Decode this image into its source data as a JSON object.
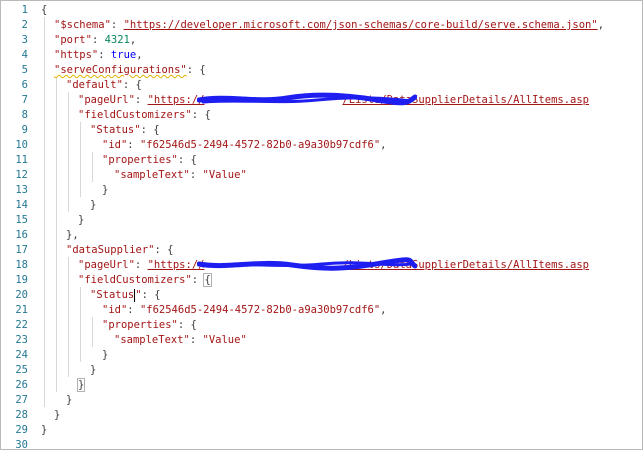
{
  "editor": {
    "line_numbers": [
      "1",
      "2",
      "3",
      "4",
      "5",
      "6",
      "7",
      "8",
      "9",
      "10",
      "11",
      "12",
      "13",
      "14",
      "15",
      "16",
      "17",
      "18",
      "19",
      "20",
      "21",
      "22",
      "23",
      "24",
      "25",
      "26",
      "27",
      "28",
      "29",
      "30"
    ],
    "colors": {
      "line_number": "#237893",
      "string": "#a31515",
      "number": "#098658",
      "keyword": "#0000ff",
      "punct": "#3b3b3b",
      "redaction": "#1e1ef0"
    }
  },
  "code": {
    "l1_brace": "{",
    "l2_key": "\"$schema\"",
    "l2_colon": ": ",
    "l2_value": "\"https://developer.microsoft.com/json-schemas/core-build/serve.schema.json\"",
    "l2_comma": ",",
    "l3_key": "\"port\"",
    "l3_colon": ": ",
    "l3_value": "4321",
    "l3_comma": ",",
    "l4_key": "\"https\"",
    "l4_colon": ": ",
    "l4_value": "true",
    "l4_comma": ",",
    "l5_key": "\"serveConfigurations\"",
    "l5_rest": ": {",
    "l6_key": "\"default\"",
    "l6_rest": ": {",
    "l7_key": "\"pageUrl\"",
    "l7_colon": ": ",
    "l7_value_start": "\"https://",
    "l7_value_end": "/Lists/DataSupplierDetails/AllItems.asp",
    "l8_key": "\"fieldCustomizers\"",
    "l8_rest": ": {",
    "l9_key": "\"Status\"",
    "l9_rest": ": {",
    "l10_key": "\"id\"",
    "l10_colon": ": ",
    "l10_value": "\"f62546d5-2494-4572-82b0-a9a30b97cdf6\"",
    "l10_comma": ",",
    "l11_key": "\"properties\"",
    "l11_rest": ": {",
    "l12_key": "\"sampleText\"",
    "l12_colon": ": ",
    "l12_value": "\"Value\"",
    "l13_text": "}",
    "l14_text": "}",
    "l15_text": "}",
    "l16_text": "},",
    "l17_key": "\"dataSupplier\"",
    "l17_rest": ": {",
    "l18_key": "\"pageUrl\"",
    "l18_colon": ": ",
    "l18_value_start": "\"https://",
    "l18_value_end": "/Lists/DataSupplierDetails/AllItems.asp",
    "l19_key": "\"fieldCustomizers\"",
    "l19_colon": ": ",
    "l19_brace": "{",
    "l20_key_a": "\"Status",
    "l20_key_b": "\"",
    "l20_rest": ": {",
    "l21_key": "\"id\"",
    "l21_colon": ": ",
    "l21_value": "\"f62546d5-2494-4572-82b0-a9a30b97cdf6\"",
    "l21_comma": ",",
    "l22_key": "\"properties\"",
    "l22_rest": ": {",
    "l23_key": "\"sampleText\"",
    "l23_colon": ": ",
    "l23_value": "\"Value\"",
    "l24_text": "}",
    "l25_text": "}",
    "l26_text": "}",
    "l27_text": "}",
    "l28_text": "}",
    "l29_text": "}"
  }
}
